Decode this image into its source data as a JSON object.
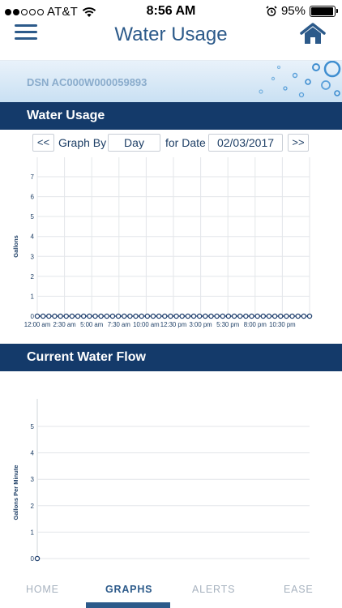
{
  "status_bar": {
    "carrier": "AT&T",
    "time": "8:56 AM",
    "battery_percent": "95%",
    "battery_level": 0.95,
    "signal_bars_filled": 2,
    "signal_bars_total": 5
  },
  "header": {
    "title": "Water Usage",
    "menu_icon": "hamburger-icon",
    "home_icon": "home-icon"
  },
  "banner": {
    "dsn": "DSN AC000W000059893"
  },
  "usage_section": {
    "title": "Water Usage",
    "prev_label": "<<",
    "graph_by_label": "Graph By",
    "graph_by_value": "Day",
    "for_date_label": "for Date",
    "date_value": "02/03/2017",
    "next_label": ">>"
  },
  "flow_section": {
    "title": "Current Water Flow"
  },
  "tabs": [
    {
      "label": "HOME",
      "active": false
    },
    {
      "label": "GRAPHS",
      "active": true
    },
    {
      "label": "ALERTS",
      "active": false
    },
    {
      "label": "EASE",
      "active": false
    }
  ],
  "colors": {
    "navy": "#143a6a",
    "accent": "#2c5a8a",
    "series": "#1f3f6e"
  },
  "chart_data": [
    {
      "type": "line",
      "ylabel": "Gallons",
      "ylim": [
        0,
        7
      ],
      "yticks": [
        0,
        1,
        2,
        3,
        4,
        5,
        6,
        7
      ],
      "xtick_labels": [
        "12:00 am",
        "2:30 am",
        "5:00 am",
        "7:30 am",
        "10:00 am",
        "12:30 pm",
        "3:00 pm",
        "5:30 pm",
        "8:00 pm",
        "10:30 pm"
      ],
      "point_count": 48,
      "values": [
        0,
        0,
        0,
        0,
        0,
        0,
        0,
        0,
        0,
        0,
        0,
        0,
        0,
        0,
        0,
        0,
        0,
        0,
        0,
        0,
        0,
        0,
        0,
        0,
        0,
        0,
        0,
        0,
        0,
        0,
        0,
        0,
        0,
        0,
        0,
        0,
        0,
        0,
        0,
        0,
        0,
        0,
        0,
        0,
        0,
        0,
        0,
        0
      ],
      "grid": true
    },
    {
      "type": "line",
      "ylabel": "Gallons Per Minute",
      "ylim": [
        0,
        5
      ],
      "yticks": [
        0,
        1,
        2,
        3,
        4,
        5
      ],
      "values": [
        0
      ],
      "grid": true
    }
  ]
}
